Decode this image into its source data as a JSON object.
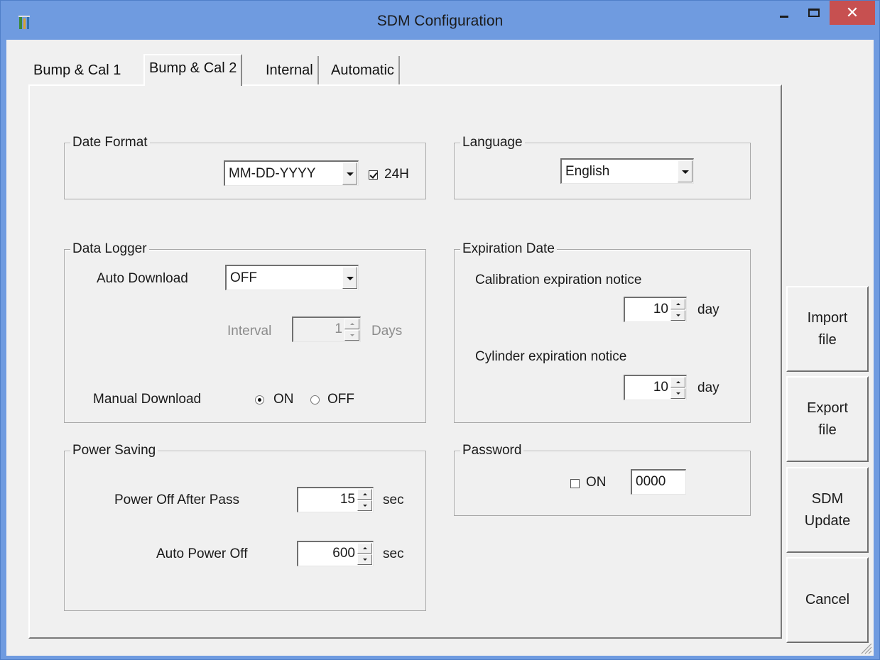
{
  "window": {
    "title": "SDM Configuration",
    "close_glyph": "✕"
  },
  "tabs": [
    {
      "label": "Bump & Cal 1",
      "active": false
    },
    {
      "label": "Bump & Cal 2",
      "active": true
    },
    {
      "label": "Internal",
      "active": false
    },
    {
      "label": "Automatic",
      "active": false
    }
  ],
  "date_format": {
    "group_label": "Date Format",
    "selected": "MM-DD-YYYY",
    "h24_label": "24H",
    "h24_checked": true
  },
  "language": {
    "group_label": "Language",
    "selected": "English"
  },
  "data_logger": {
    "group_label": "Data Logger",
    "auto_download_label": "Auto Download",
    "auto_download_value": "OFF",
    "interval_label": "Interval",
    "interval_value": "1",
    "interval_unit": "Days",
    "manual_download_label": "Manual Download",
    "manual_on_label": "ON",
    "manual_off_label": "OFF",
    "manual_selected": "ON"
  },
  "expiration_date": {
    "group_label": "Expiration Date",
    "calibration_label": "Calibration expiration notice",
    "calibration_value": "10",
    "calibration_unit": "day",
    "cylinder_label": "Cylinder expiration notice",
    "cylinder_value": "10",
    "cylinder_unit": "day"
  },
  "power_saving": {
    "group_label": "Power Saving",
    "after_pass_label": "Power Off After Pass",
    "after_pass_value": "15",
    "after_pass_unit": "sec",
    "auto_off_label": "Auto Power Off",
    "auto_off_value": "600",
    "auto_off_unit": "sec"
  },
  "password": {
    "group_label": "Password",
    "on_label": "ON",
    "on_checked": false,
    "value": "0000"
  },
  "side_buttons": {
    "import": "Import\nfile",
    "export": "Export\nfile",
    "update": "SDM\nUpdate",
    "cancel": "Cancel"
  }
}
